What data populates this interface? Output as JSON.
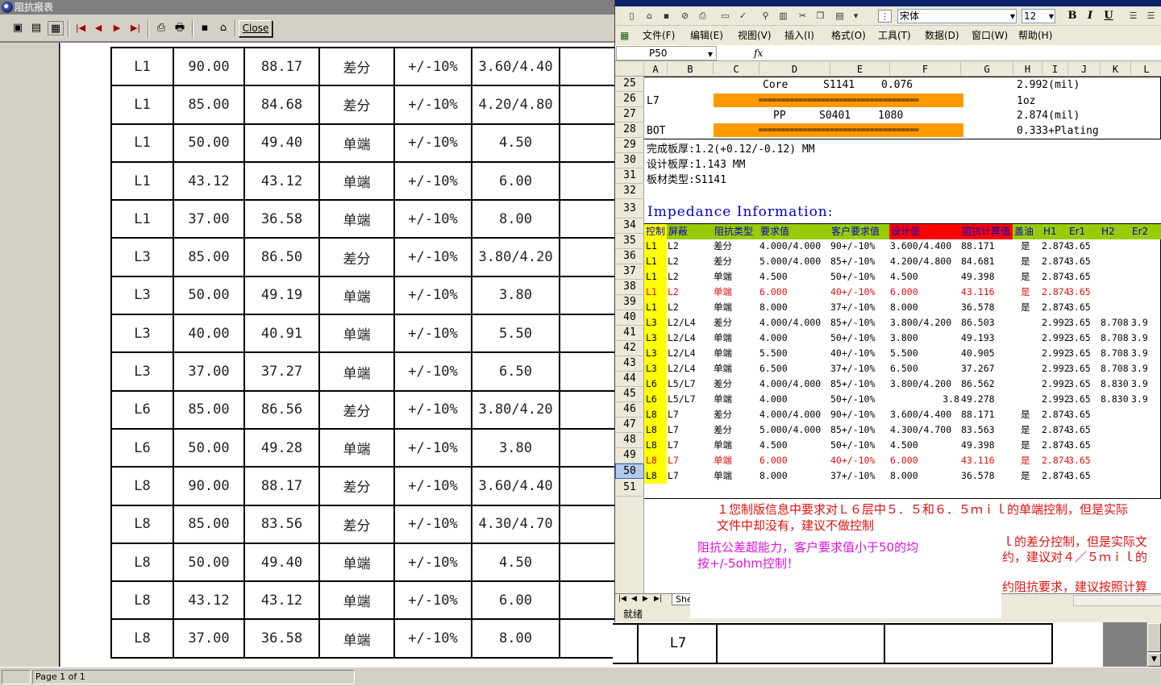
{
  "report": {
    "window_title": "阻抗报表",
    "close_label": "Close",
    "status_page": "Page 1 of 1",
    "rows": [
      [
        "L1",
        "90.00",
        "88.17",
        "差分",
        "+/-10%",
        "3.60/4.40"
      ],
      [
        "L1",
        "85.00",
        "84.68",
        "差分",
        "+/-10%",
        "4.20/4.80"
      ],
      [
        "L1",
        "50.00",
        "49.40",
        "单端",
        "+/-10%",
        "4.50"
      ],
      [
        "L1",
        "43.12",
        "43.12",
        "单端",
        "+/-10%",
        "6.00"
      ],
      [
        "L1",
        "37.00",
        "36.58",
        "单端",
        "+/-10%",
        "8.00"
      ],
      [
        "L3",
        "85.00",
        "86.50",
        "差分",
        "+/-10%",
        "3.80/4.20"
      ],
      [
        "L3",
        "50.00",
        "49.19",
        "单端",
        "+/-10%",
        "3.80"
      ],
      [
        "L3",
        "40.00",
        "40.91",
        "单端",
        "+/-10%",
        "5.50"
      ],
      [
        "L3",
        "37.00",
        "37.27",
        "单端",
        "+/-10%",
        "6.50"
      ],
      [
        "L6",
        "85.00",
        "86.56",
        "差分",
        "+/-10%",
        "3.80/4.20"
      ],
      [
        "L6",
        "50.00",
        "49.28",
        "单端",
        "+/-10%",
        "3.80"
      ],
      [
        "L8",
        "90.00",
        "88.17",
        "差分",
        "+/-10%",
        "3.60/4.40"
      ],
      [
        "L8",
        "85.00",
        "83.56",
        "差分",
        "+/-10%",
        "4.30/4.70"
      ],
      [
        "L8",
        "50.00",
        "49.40",
        "单端",
        "+/-10%",
        "4.50"
      ],
      [
        "L8",
        "43.12",
        "43.12",
        "单端",
        "+/-10%",
        "6.00"
      ],
      [
        "L8",
        "37.00",
        "36.58",
        "单端",
        "+/-10%",
        "8.00"
      ]
    ],
    "bottom_ref": "L7"
  },
  "excel": {
    "font_name": "宋体",
    "font_size": "12",
    "menu": [
      "文件(F)",
      "编辑(E)",
      "视图(V)",
      "插入(I)",
      "格式(O)",
      "工具(T)",
      "数据(D)",
      "窗口(W)",
      "帮助(H)"
    ],
    "name_box": "P50",
    "fx": "fx",
    "columns": [
      "A",
      "B",
      "C",
      "D",
      "E",
      "F",
      "G",
      "H",
      "I",
      "J",
      "K",
      "L"
    ],
    "row_numbers": [
      "25",
      "26",
      "27",
      "28",
      "29",
      "30",
      "31",
      "32",
      "33",
      "34",
      "35",
      "36",
      "37",
      "38",
      "39",
      "40",
      "41",
      "42",
      "43",
      "44",
      "45",
      "46",
      "47",
      "48",
      "49",
      "50",
      "51"
    ],
    "stack": {
      "r25_core": "Core",
      "r25_mat": "S1141",
      "r25_val": "0.076",
      "r25_thick": "2.992(mil)",
      "r26_layer": "L7",
      "r26_bar": "====================================",
      "r26_cu": "1oz",
      "r27_pp": "PP",
      "r27_mat": "S0401",
      "r27_val": "1080",
      "r27_thick": "2.874(mil)",
      "r28_layer": "BOT",
      "r28_bar": "====================================",
      "r28_plating": "0.333+Plating"
    },
    "info": {
      "finished": "完成板厚:1.2(+0.12/-0.12) MM",
      "design": "设计板厚:1.143 MM",
      "material": "板材类型:S1141",
      "heading": "Impedance Information:"
    },
    "imp_headers": [
      "控制",
      "屏蔽",
      "阻抗类型",
      "要求值",
      "客户要求值",
      "设计值",
      "阻抗计算值",
      "盖油",
      "H1",
      "Er1",
      "H2",
      "Er2"
    ],
    "header_colors": {
      "green": "#99cc00",
      "yellow": "#ffff00",
      "red": "#ff0000",
      "blue_text": "#0000cc"
    },
    "imp_rows": [
      {
        "c": "L1",
        "s": "L2",
        "t": "差分",
        "req": "4.000/4.000",
        "cust": "90+/-10%",
        "des": "3.600/4.400",
        "calc": "88.171",
        "oil": "是",
        "h1": "2.874",
        "er1": "3.65",
        "h2": "",
        "er2": "",
        "red": false
      },
      {
        "c": "L1",
        "s": "L2",
        "t": "差分",
        "req": "5.000/4.000",
        "cust": "85+/-10%",
        "des": "4.200/4.800",
        "calc": "84.681",
        "oil": "是",
        "h1": "2.874",
        "er1": "3.65",
        "h2": "",
        "er2": "",
        "red": false
      },
      {
        "c": "L1",
        "s": "L2",
        "t": "单端",
        "req": "4.500",
        "cust": "50+/-10%",
        "des": "4.500",
        "calc": "49.398",
        "oil": "是",
        "h1": "2.874",
        "er1": "3.65",
        "h2": "",
        "er2": "",
        "red": false
      },
      {
        "c": "L1",
        "s": "L2",
        "t": "单端",
        "req": "6.000",
        "cust": "40+/-10%",
        "des": "6.000",
        "calc": "43.116",
        "oil": "是",
        "h1": "2.874",
        "er1": "3.65",
        "h2": "",
        "er2": "",
        "red": true
      },
      {
        "c": "L1",
        "s": "L2",
        "t": "单端",
        "req": "8.000",
        "cust": "37+/-10%",
        "des": "8.000",
        "calc": "36.578",
        "oil": "是",
        "h1": "2.874",
        "er1": "3.65",
        "h2": "",
        "er2": "",
        "red": false
      },
      {
        "c": "L3",
        "s": "L2/L4",
        "t": "差分",
        "req": "4.000/4.000",
        "cust": "85+/-10%",
        "des": "3.800/4.200",
        "calc": "86.503",
        "oil": "",
        "h1": "2.992",
        "er1": "3.65",
        "h2": "8.708",
        "er2": "3.9",
        "red": false
      },
      {
        "c": "L3",
        "s": "L2/L4",
        "t": "单端",
        "req": "4.000",
        "cust": "50+/-10%",
        "des": "3.800",
        "calc": "49.193",
        "oil": "",
        "h1": "2.992",
        "er1": "3.65",
        "h2": "8.708",
        "er2": "3.9",
        "red": false
      },
      {
        "c": "L3",
        "s": "L2/L4",
        "t": "单端",
        "req": "5.500",
        "cust": "40+/-10%",
        "des": "5.500",
        "calc": "40.905",
        "oil": "",
        "h1": "2.992",
        "er1": "3.65",
        "h2": "8.708",
        "er2": "3.9",
        "red": false
      },
      {
        "c": "L3",
        "s": "L2/L4",
        "t": "单端",
        "req": "6.500",
        "cust": "37+/-10%",
        "des": "6.500",
        "calc": "37.267",
        "oil": "",
        "h1": "2.992",
        "er1": "3.65",
        "h2": "8.708",
        "er2": "3.9",
        "red": false
      },
      {
        "c": "L6",
        "s": "L5/L7",
        "t": "差分",
        "req": "4.000/4.000",
        "cust": "85+/-10%",
        "des": "3.800/4.200",
        "calc": "86.562",
        "oil": "",
        "h1": "2.992",
        "er1": "3.65",
        "h2": "8.830",
        "er2": "3.9",
        "red": false
      },
      {
        "c": "L6",
        "s": "L5/L7",
        "t": "单端",
        "req": "4.000",
        "cust": "50+/-10%",
        "des": "3.8",
        "calc": "49.278",
        "oil": "",
        "h1": "2.992",
        "er1": "3.65",
        "h2": "8.830",
        "er2": "3.9",
        "red": false
      },
      {
        "c": "L8",
        "s": "L7",
        "t": "差分",
        "req": "4.000/4.000",
        "cust": "90+/-10%",
        "des": "3.600/4.400",
        "calc": "88.171",
        "oil": "是",
        "h1": "2.874",
        "er1": "3.65",
        "h2": "",
        "er2": "",
        "red": false
      },
      {
        "c": "L8",
        "s": "L7",
        "t": "差分",
        "req": "5.000/4.000",
        "cust": "85+/-10%",
        "des": "4.300/4.700",
        "calc": "83.563",
        "oil": "是",
        "h1": "2.874",
        "er1": "3.65",
        "h2": "",
        "er2": "",
        "red": false
      },
      {
        "c": "L8",
        "s": "L7",
        "t": "单端",
        "req": "4.500",
        "cust": "50+/-10%",
        "des": "4.500",
        "calc": "49.398",
        "oil": "是",
        "h1": "2.874",
        "er1": "3.65",
        "h2": "",
        "er2": "",
        "red": false
      },
      {
        "c": "L8",
        "s": "L7",
        "t": "单端",
        "req": "6.000",
        "cust": "40+/-10%",
        "des": "6.000",
        "calc": "43.116",
        "oil": "是",
        "h1": "2.874",
        "er1": "3.65",
        "h2": "",
        "er2": "",
        "red": true
      },
      {
        "c": "L8",
        "s": "L7",
        "t": "单端",
        "req": "8.000",
        "cust": "37+/-10%",
        "des": "8.000",
        "calc": "36.578",
        "oil": "是",
        "h1": "2.874",
        "er1": "3.65",
        "h2": "",
        "er2": "",
        "red": false
      }
    ],
    "notes": {
      "n1a": "１您制版信息中要求对Ｌ６层中５．５和６．５ｍｉｌ的单端控制，但是实际",
      "n1b": "文件中却没有，建议不做控制",
      "n2a": "阻抗公差超能力，客户要求值小于50的均",
      "n2b": "按+/-5ohm控制！",
      "n3a": "ｌ的差分控制，但是实际文",
      "n3b": "约，建议对４／５ｍｉｌ的",
      "n4": "约阻抗要求，建议按照计算"
    },
    "note_colors": {
      "red": "#e01010",
      "magenta": "#e010e0"
    },
    "sheet_tab": "She",
    "status": "就绪"
  }
}
